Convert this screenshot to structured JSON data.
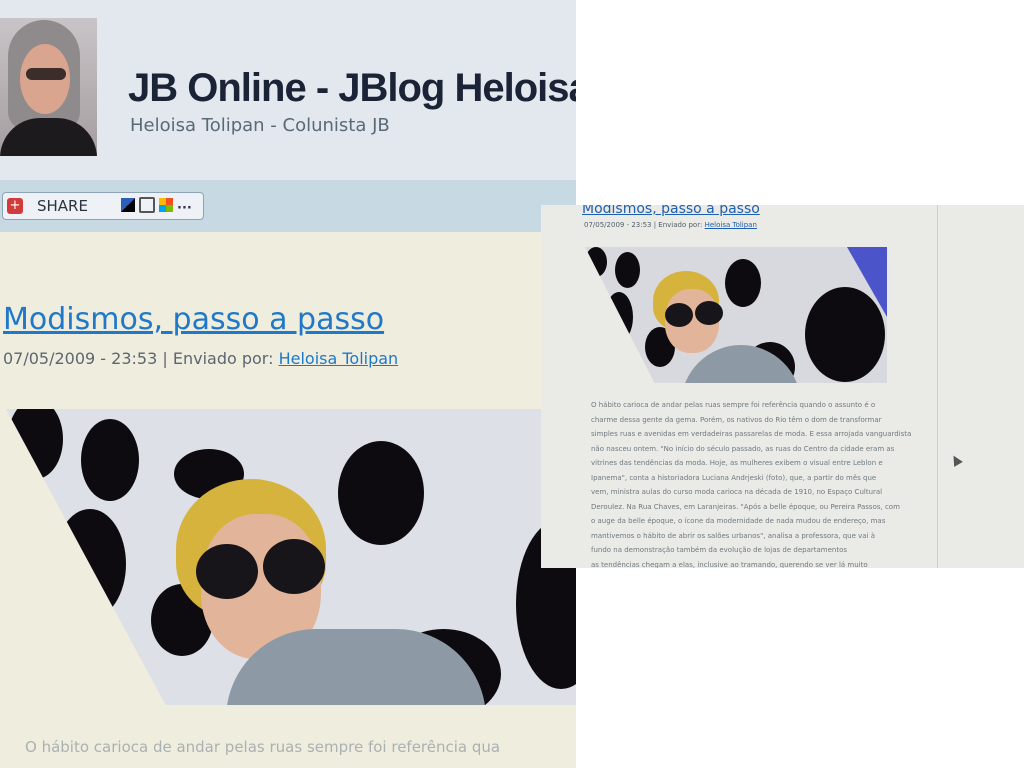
{
  "site": {
    "title": "JB Online - JBlog Heloisa",
    "subtitle": "Heloisa Tolipan - Colunista JB"
  },
  "share": {
    "label": "SHARE",
    "more": "..."
  },
  "post": {
    "title": "Modismos, passo a passo",
    "date": "07/05/2009 - 23:53",
    "sent_by_prefix": "| Enviado por:",
    "author": "Heloisa Tolipan",
    "first_line": "O hábito carioca de andar pelas ruas sempre foi referência qua"
  },
  "zoomed_out": {
    "title": "Modismos, passo a passo",
    "meta_prefix": "07/05/2009 - 23:53 | Enviado por:",
    "author": "Heloisa Tolipan",
    "body_lines": [
      "O hábito carioca de andar pelas ruas sempre foi referência quando o assunto é o",
      "charme dessa gente da gema. Porém, os nativos do Rio têm o dom de transformar",
      "simples ruas e avenidas em verdadeiras passarelas de moda. E essa arrojada vanguardista",
      "não nasceu ontem. \"No início do século passado, as ruas do Centro da cidade eram as",
      "vitrines das tendências da moda. Hoje, as mulheres exibem o visual entre Leblon e",
      "Ipanema\", conta a historiadora Luciana Andrjeski (foto), que, a partir do mês que",
      "vem, ministra aulas do curso moda carioca na década de 1910, no Espaço Cultural",
      "Deroulez. Na Rua Chaves, em Laranjeiras. \"Após a belle époque, ou Pereira Passos, com",
      "o auge da belle époque, o ícone da modernidade de nada mudou de endereço, mas",
      "mantivemos o hábito de abrir os salões urbanos\", analisa a professora, que vai à",
      "fundo na demonstração também da evolução de lojas de departamentos",
      "as tendências chegam a elas, inclusive ao tramando, querendo se ver lá muito"
    ]
  }
}
